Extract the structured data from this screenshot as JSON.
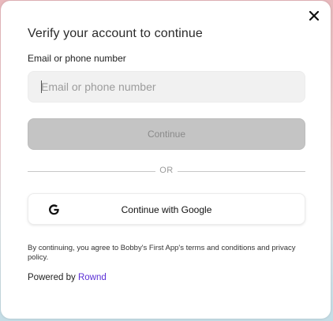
{
  "modal": {
    "title": "Verify your account to continue",
    "close_icon": "close-icon",
    "field_label": "Email or phone number",
    "input_placeholder": "Email or phone number",
    "input_value": "",
    "continue_label": "Continue",
    "continue_enabled": false,
    "divider_text": "OR",
    "google_label": "Continue with Google",
    "google_icon": "google-icon",
    "terms_text": "By continuing, you agree to Bobby's First App's terms and conditions and privacy policy.",
    "powered_prefix": "Powered by",
    "powered_link": "Rownd"
  },
  "colors": {
    "link": "#5b2fd6",
    "continue_disabled_bg": "#c4c4c4",
    "input_bg": "#f1f1f1"
  }
}
